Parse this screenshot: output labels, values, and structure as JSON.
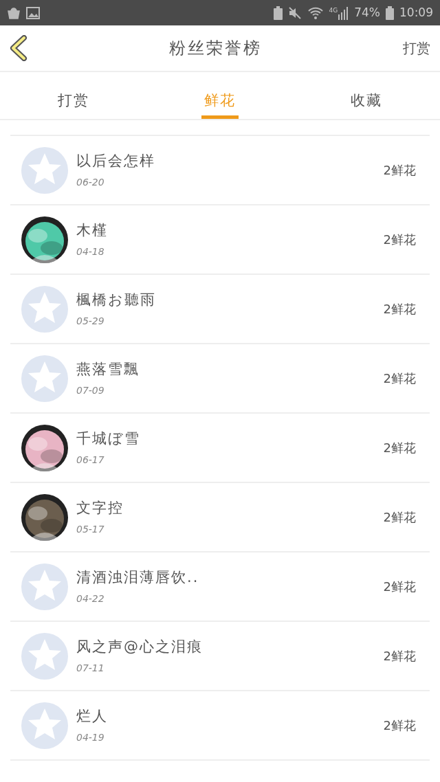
{
  "status_bar": {
    "network": "4G",
    "battery": "74%",
    "time": "10:09"
  },
  "header": {
    "title": "粉丝荣誉榜",
    "action": "打赏"
  },
  "tabs": [
    {
      "label": "打赏",
      "selected": false
    },
    {
      "label": "鲜花",
      "selected": true
    },
    {
      "label": "收藏",
      "selected": false
    }
  ],
  "rows": [
    {
      "name": "以后会怎样",
      "date": "06-20",
      "amount": "2鲜花",
      "avatar": {
        "kind": "default"
      }
    },
    {
      "name": "木槿",
      "date": "04-18",
      "amount": "2鲜花"
    },
    {
      "name": "楓橋お聽雨",
      "date": "05-29",
      "amount": "2鲜花",
      "avatar": {
        "kind": "default"
      }
    },
    {
      "name": "燕落雪飄",
      "date": "07-09",
      "amount": "2鲜花",
      "avatar": {
        "kind": "default"
      }
    },
    {
      "name": "千城ぼ雪",
      "date": "06-17",
      "amount": "2鲜花"
    },
    {
      "name": "文字控",
      "date": "05-17",
      "amount": "2鲜花"
    },
    {
      "name": "清酒浊泪薄唇饮..",
      "date": "04-22",
      "amount": "2鲜花",
      "avatar": {
        "kind": "default"
      }
    },
    {
      "name": "风之声@心之泪痕",
      "date": "07-11",
      "amount": "2鲜花",
      "avatar": {
        "kind": "default"
      }
    },
    {
      "name": "烂人",
      "date": "04-19",
      "amount": "2鲜花",
      "avatar": {
        "kind": "default"
      }
    }
  ]
}
